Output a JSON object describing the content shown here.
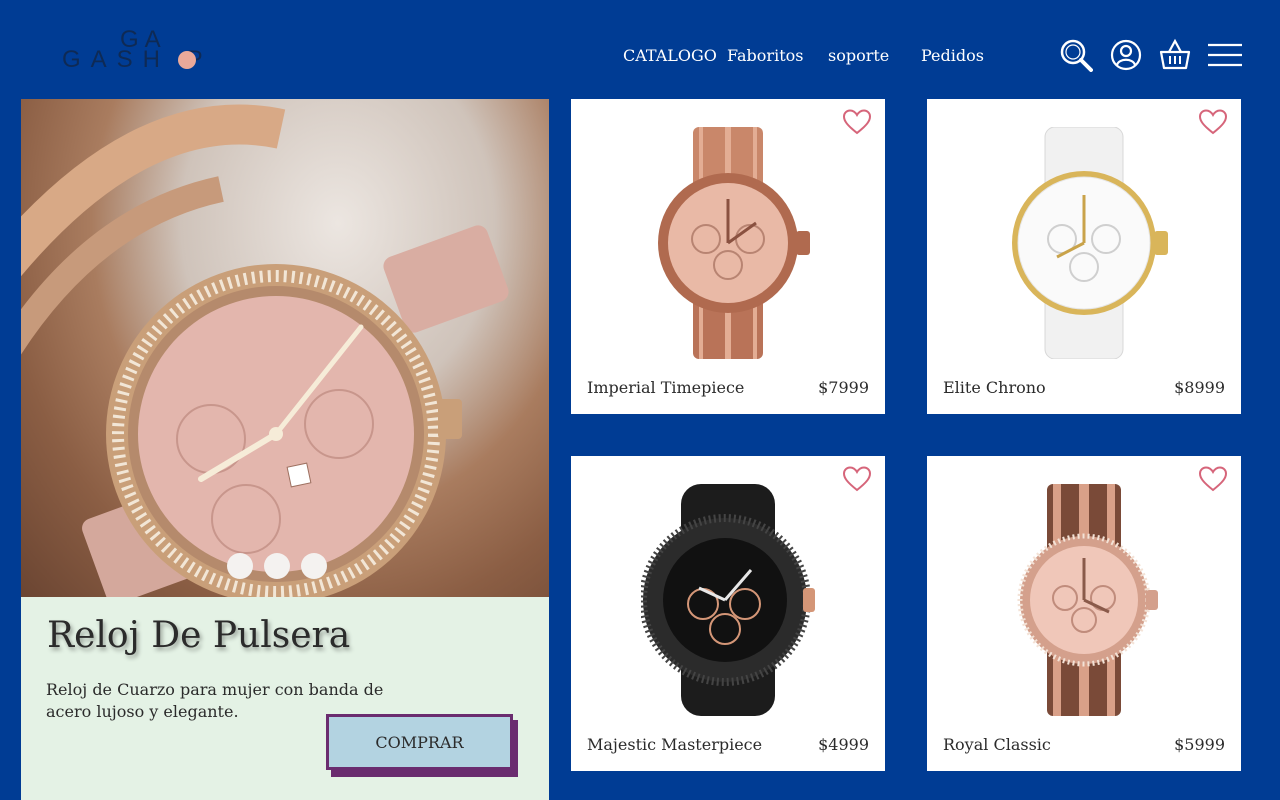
{
  "brand": {
    "line1": "GA",
    "line2": "GASH P"
  },
  "nav": {
    "items": [
      {
        "label": "CATALOGO"
      },
      {
        "label": "Faboritos"
      },
      {
        "label": "soporte"
      },
      {
        "label": "Pedidos"
      }
    ]
  },
  "header_icons": [
    "search-icon",
    "user-icon",
    "basket-icon",
    "menu-icon"
  ],
  "hero": {
    "title": "Reloj De Pulsera",
    "description": "Reloj de Cuarzo para mujer con banda de acero lujoso y elegante.",
    "button_label": "COMPRAR",
    "carousel_dots": 3
  },
  "products": [
    {
      "name": "Imperial Timepiece",
      "price": "$7999",
      "style": "rose-gold"
    },
    {
      "name": "Elite Chrono",
      "price": "$8999",
      "style": "white-gold"
    },
    {
      "name": "Majestic Masterpiece",
      "price": "$4999",
      "style": "black"
    },
    {
      "name": "Royal Classic",
      "price": "$5999",
      "style": "tortoise-rose"
    }
  ],
  "colors": {
    "background": "#003c94",
    "hero_panel": "#e4f2e5",
    "button": "#b3d3e1",
    "button_border": "#6a2c6f",
    "heart": "#d6657a"
  }
}
